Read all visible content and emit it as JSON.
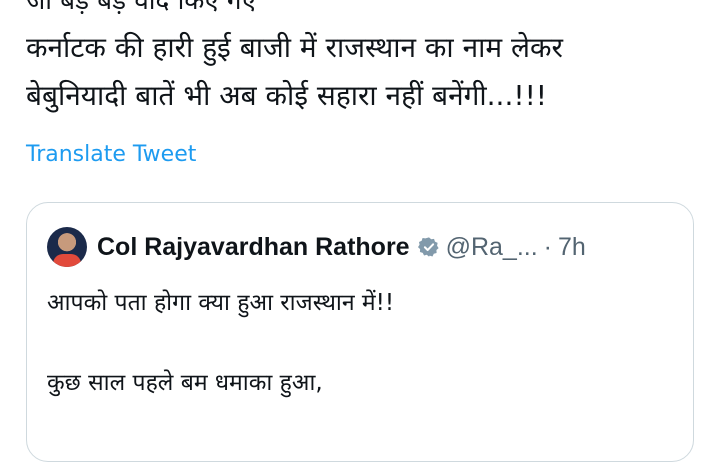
{
  "tweet": {
    "cut_off_line": "जो बड़े बड़े वादे किए गए",
    "text_line_1": "कर्नाटक की हारी हुई बाजी में राजस्थान का नाम लेकर",
    "text_line_2": "बेबुनियादी बातें भी अब कोई सहारा नहीं बनेंगी...!!!",
    "translate_label": "Translate Tweet"
  },
  "quoted_tweet": {
    "author_name": "Col Rajyavardhan Rathore",
    "handle": "@Ra_...",
    "separator": "·",
    "time": "7h",
    "line_1": "आपको पता होगा क्या हुआ राजस्थान में!!",
    "line_2": "कुछ साल पहले बम धमाका हुआ,"
  },
  "colors": {
    "link": "#1d9bf0",
    "verified_badge": "#829aab",
    "muted_text": "#536471",
    "border": "#cfd9de"
  },
  "icons": {
    "verified": "verified-badge-icon",
    "avatar": "author-avatar"
  }
}
